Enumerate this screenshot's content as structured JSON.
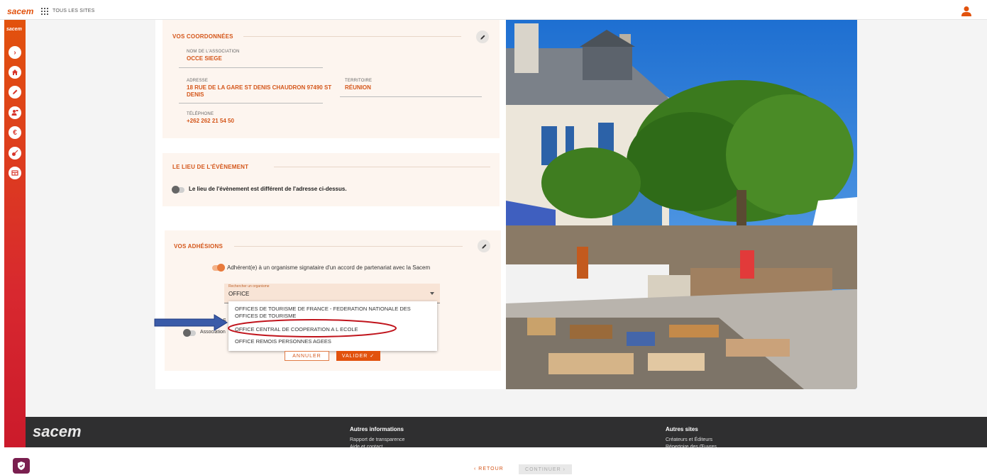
{
  "topbar": {
    "logo": "sacem",
    "all_sites": "TOUS LES SITES"
  },
  "sidebar": {
    "mini_logo": "sacem",
    "buttons": [
      "chevron-right-icon",
      "home-icon",
      "pencil-icon",
      "user-money-icon",
      "euro-icon",
      "guitar-icon",
      "table-icon"
    ]
  },
  "coordonnees": {
    "title": "VOS COORDONNÉES",
    "association_label": "NOM DE L'ASSOCIATION",
    "association_value": "OCCE SIEGE",
    "adresse_label": "ADRESSE",
    "adresse_line1": "18 RUE DE LA GARE ST DENIS CHAUDRON 97490 ST",
    "adresse_line2": "DENIS",
    "territoire_label": "TERRITOIRE",
    "territoire_value": "RÉUNION",
    "telephone_label": "TÉLÉPHONE",
    "telephone_value": "+262 262 21 54 50"
  },
  "lieu": {
    "title": "LE LIEU DE L'ÉVÈNEMENT",
    "toggle_label": "Le lieu de l'évènement est différent de l'adresse ci-dessus."
  },
  "adhesions": {
    "title": "VOS ADHÉSIONS",
    "toggle_label": "Adhérent(e) à un organisme signataire d'un accord de partenariat avec la Sacem",
    "search_label": "Rechercher un organisme",
    "search_value": "OFFICE",
    "partial_text_s": "S",
    "association_label": "Association",
    "options": [
      "OFFICES DE TOURISME DE FRANCE - FEDERATION NATIONALE DES",
      "OFFICES DE TOURISME",
      "OFFICE CENTRAL DE COOPERATION A L ECOLE",
      "OFFICE REMOIS PERSONNES AGEES"
    ],
    "cancel_label": "ANNULER",
    "validate_label": "VALIDER"
  },
  "footer": {
    "logo": "sacem",
    "col1_title": "Autres informations",
    "col1_links": [
      "Rapport de transparence",
      "Aide et contact"
    ],
    "col2_title": "Autres sites",
    "col2_links": [
      "Créateurs et Éditeurs",
      "Répertoire des Œuvres"
    ]
  },
  "navigation": {
    "back_label": "RETOUR",
    "continue_label": "CONTINUER"
  },
  "colors": {
    "brand_orange": "#e2520d",
    "annotation_red": "#c0141c",
    "annotation_blue": "#3a5ba8"
  }
}
